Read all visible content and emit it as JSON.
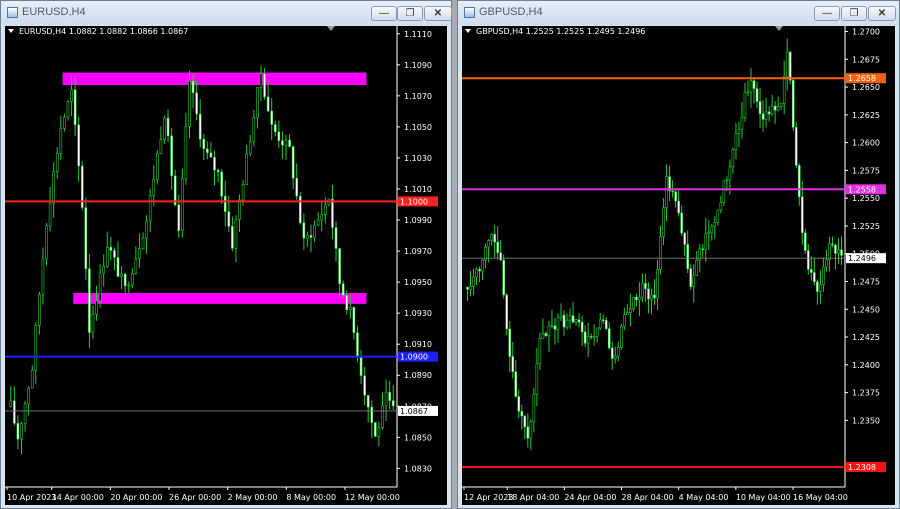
{
  "windows": [
    {
      "id": "eur",
      "title": "EURUSD,H4",
      "info": "EURUSD,H4  1.0882 1.0882 1.0866 1.0867",
      "buttons": {
        "minimize": "—",
        "maximize": "❐",
        "close": "✕"
      },
      "price_axis": {
        "min": 1.0818,
        "max": 1.1115,
        "ticks": [
          "1.1110",
          "1.1090",
          "1.1070",
          "1.1050",
          "1.1030",
          "1.1010",
          "1.0990",
          "1.0970",
          "1.0950",
          "1.0930",
          "1.0910",
          "1.0890",
          "1.0870",
          "1.0850",
          "1.0830"
        ]
      },
      "time_axis": [
        "10 Apr 2023",
        "14 Apr 00:00",
        "20 Apr 00:00",
        "26 Apr 00:00",
        "2 May 00:00",
        "8 May 00:00",
        "12 May 00:00"
      ],
      "current_price": "1.0867",
      "horizontal_lines": [
        {
          "price": 1.1002,
          "color": "#ff2020",
          "label": "1.1000"
        },
        {
          "price": 1.0902,
          "color": "#2020ff",
          "label": "1.0900"
        },
        {
          "price": 1.0867,
          "color": "#808080",
          "label": ""
        }
      ],
      "zones": [
        {
          "top": 1.1085,
          "bottom": 1.1077,
          "start_index": 15,
          "end_index": 100,
          "color": "#ff00ff"
        },
        {
          "top": 1.0943,
          "bottom": 1.0936,
          "start_index": 18,
          "end_index": 100,
          "color": "#ff00ff"
        }
      ],
      "candles": {
        "count": 108,
        "anchors": [
          [
            0,
            1.087
          ],
          [
            2,
            1.085
          ],
          [
            6,
            1.0895
          ],
          [
            10,
            1.099
          ],
          [
            14,
            1.105
          ],
          [
            17,
            1.1072
          ],
          [
            20,
            1.1
          ],
          [
            22,
            1.092
          ],
          [
            27,
            1.0975
          ],
          [
            32,
            1.0945
          ],
          [
            38,
            1.099
          ],
          [
            43,
            1.106
          ],
          [
            47,
            1.098
          ],
          [
            50,
            1.108
          ],
          [
            54,
            1.1035
          ],
          [
            58,
            1.102
          ],
          [
            62,
            1.0975
          ],
          [
            66,
            1.103
          ],
          [
            70,
            1.1085
          ],
          [
            73,
            1.105
          ],
          [
            78,
            1.1035
          ],
          [
            82,
            1.0975
          ],
          [
            86,
            1.099
          ],
          [
            89,
            1.1005
          ],
          [
            92,
            1.095
          ],
          [
            95,
            1.093
          ],
          [
            99,
            1.088
          ],
          [
            102,
            1.085
          ],
          [
            105,
            1.0875
          ],
          [
            107,
            1.0867
          ]
        ]
      }
    },
    {
      "id": "gbp",
      "title": "GBPUSD,H4",
      "info": "GBPUSD,H4  1.2525 1.2525 1.2495 1.2496",
      "buttons": {
        "minimize": "—",
        "maximize": "❐",
        "close": "✕"
      },
      "price_axis": {
        "min": 1.229,
        "max": 1.2705,
        "ticks": [
          "1.2700",
          "1.2675",
          "1.2650",
          "1.2625",
          "1.2600",
          "1.2575",
          "1.2550",
          "1.2525",
          "1.2500",
          "1.2475",
          "1.2450",
          "1.2425",
          "1.2400",
          "1.2375",
          "1.2350"
        ]
      },
      "time_axis": [
        "12 Apr 2023",
        "18 Apr 04:00",
        "24 Apr 04:00",
        "28 Apr 04:00",
        "4 May 04:00",
        "10 May 04:00",
        "16 May 04:00"
      ],
      "current_price": "1.2496",
      "horizontal_lines": [
        {
          "price": 1.2658,
          "color": "#ff6010",
          "label": "1.2658"
        },
        {
          "price": 1.2558,
          "color": "#e030e0",
          "label": "1.2558"
        },
        {
          "price": 1.2496,
          "color": "#808080",
          "label": ""
        },
        {
          "price": 1.2308,
          "color": "#ff1010",
          "label": "1.2308"
        }
      ],
      "zones": [],
      "candles": {
        "count": 125,
        "anchors": [
          [
            0,
            1.247
          ],
          [
            4,
            1.249
          ],
          [
            8,
            1.252
          ],
          [
            11,
            1.249
          ],
          [
            13,
            1.243
          ],
          [
            17,
            1.236
          ],
          [
            20,
            1.233
          ],
          [
            24,
            1.242
          ],
          [
            30,
            1.244
          ],
          [
            36,
            1.244
          ],
          [
            40,
            1.242
          ],
          [
            45,
            1.244
          ],
          [
            48,
            1.24
          ],
          [
            52,
            1.244
          ],
          [
            58,
            1.247
          ],
          [
            62,
            1.246
          ],
          [
            66,
            1.257
          ],
          [
            70,
            1.254
          ],
          [
            74,
            1.247
          ],
          [
            78,
            1.251
          ],
          [
            82,
            1.253
          ],
          [
            88,
            1.259
          ],
          [
            92,
            1.264
          ],
          [
            94,
            1.266
          ],
          [
            98,
            1.262
          ],
          [
            104,
            1.264
          ],
          [
            106,
            1.268
          ],
          [
            108,
            1.262
          ],
          [
            110,
            1.255
          ],
          [
            112,
            1.25
          ],
          [
            116,
            1.246
          ],
          [
            120,
            1.251
          ],
          [
            124,
            1.2496
          ]
        ]
      }
    }
  ]
}
